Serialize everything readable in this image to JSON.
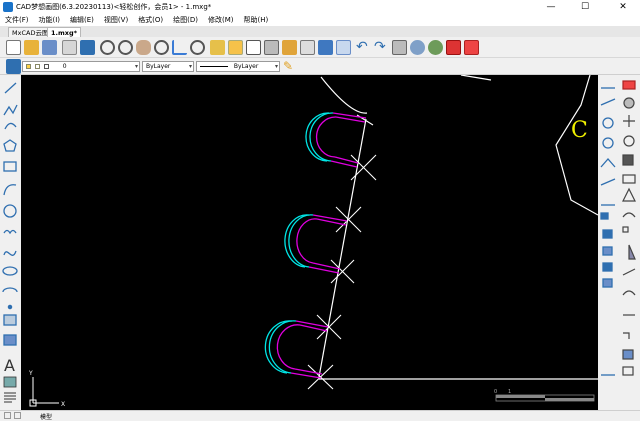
{
  "titlebar": {
    "title": "CAD梦想画图(6.3.20230113)<轻松创作，会员1> - 1.mxg*",
    "minimize": "—",
    "maximize": "☐",
    "close": "✕"
  },
  "menu": [
    "文件(F)",
    "功能(I)",
    "编辑(E)",
    "视图(V)",
    "格式(O)",
    "绘图(D)",
    "修改(M)",
    "帮助(H)"
  ],
  "tabs": {
    "home": "MxCAD云图",
    "file": "1.mxg*"
  },
  "layer_toolbar": {
    "layer_value": "0",
    "color_value": "ByLayer",
    "linetype_value": "ByLayer"
  },
  "canvas": {
    "letter_c": "C",
    "ucs_x": "X",
    "ucs_y": "Y",
    "scale_left": "0",
    "scale_right": "1"
  },
  "status": {
    "layout_tab": "模型"
  },
  "colors": {
    "canvas_bg": "#000000",
    "line_white": "#ffffff",
    "arc_cyan": "#00e5e5",
    "arc_magenta": "#e000e0",
    "letter_yellow": "#f0f000"
  },
  "icons": {
    "toolbar": [
      "new-file-icon",
      "open-file-icon",
      "save-icon",
      "print-icon",
      "zoom-window-icon",
      "zoom-extents-icon",
      "pan-icon",
      "zoom-in-icon",
      "measure-icon",
      "find-icon",
      "text-style-icon",
      "table-icon",
      "block-icon",
      "layer-manager-icon",
      "match-prop-icon",
      "undo-icon",
      "redo-icon",
      "plot-icon",
      "web-icon",
      "globe-icon",
      "pdf-icon",
      "image-export-icon"
    ],
    "left": [
      "line-icon",
      "polyline-icon",
      "arc-icon",
      "polygon-icon",
      "rectangle-icon",
      "arc-3p-icon",
      "circle-icon",
      "revision-cloud-icon",
      "spline-icon",
      "ellipse-icon",
      "ellipse-arc-icon",
      "point-icon",
      "hatch-icon",
      "region-icon",
      "text-icon",
      "image-icon",
      "mtext-icon"
    ],
    "right": [
      "dim-linear-icon",
      "erase-icon",
      "dim-aligned-icon",
      "copy-icon",
      "dim-radius-icon",
      "move-icon",
      "dim-diameter-icon",
      "rotate-icon",
      "dim-angular-icon",
      "scale-icon",
      "dim-continue-icon",
      "stretch-icon",
      "explode-icon",
      "mirror-icon",
      "offset-icon",
      "array-icon",
      "trim-icon",
      "extend-icon",
      "break-icon",
      "chamfer-icon",
      "fillet-icon",
      "3d-box-icon",
      "dim-edit-icon"
    ]
  }
}
